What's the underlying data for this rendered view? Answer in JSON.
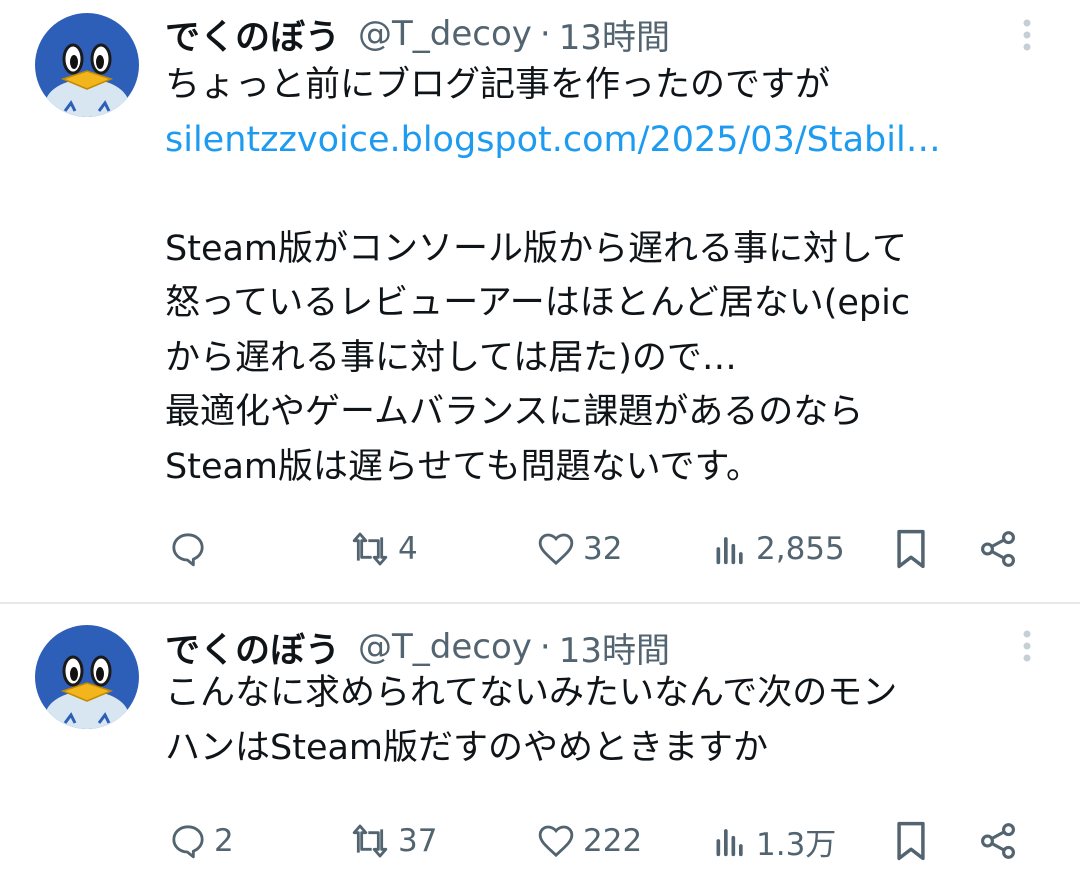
{
  "tweets": [
    {
      "author_name": "でくのぼう",
      "handle": "@T_decoy",
      "separator": "·",
      "time": "13時間",
      "lines": [
        "ちょっと前にブログ記事を作ったのですが",
        "silentzzvoice.blogspot.com/2025/03/Stabil…",
        "",
        "Steam版がコンソール版から遅れる事に対して",
        "怒っているレビューアーはほとんど居ない(epic",
        "から遅れる事に対しては居た)ので…",
        "最適化やゲームバランスに課題があるのなら",
        "Steam版は遅らせても問題ないです。"
      ],
      "counts": {
        "replies": "",
        "retweets": "4",
        "likes": "32",
        "views": "2,855"
      }
    },
    {
      "author_name": "でくのぼう",
      "handle": "@T_decoy",
      "separator": "·",
      "time": "13時間",
      "lines": [
        "こんなに求められてないみたいなんで次のモン",
        "ハンはSteam版だすのやめときますか"
      ],
      "counts": {
        "replies": "2",
        "retweets": "37",
        "likes": "222",
        "views": "1.3万"
      }
    }
  ],
  "colors": {
    "text": "#0f1419",
    "muted": "#536471",
    "link": "#1d9bf0",
    "divider": "#e6e9ec"
  },
  "icons": [
    "reply-icon",
    "retweet-icon",
    "like-icon",
    "views-icon",
    "bookmark-icon",
    "share-icon",
    "more-options-icon"
  ]
}
